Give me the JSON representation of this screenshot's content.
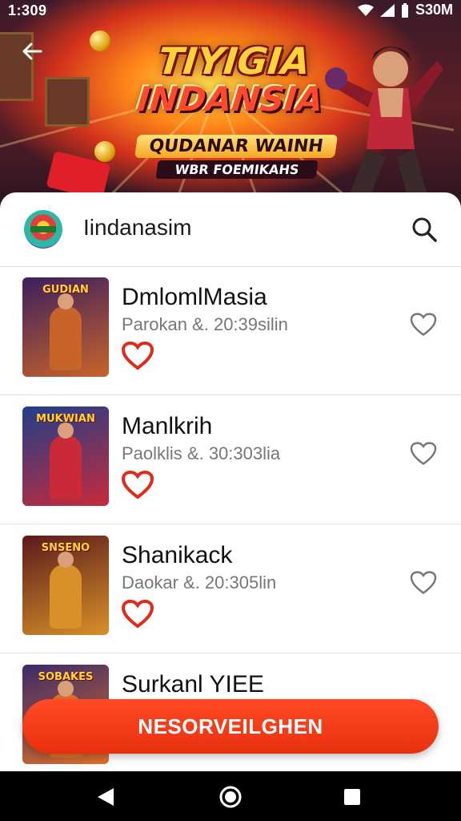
{
  "status_bar": {
    "time": "1:309",
    "battery": "S30M"
  },
  "hero": {
    "title_line1": "TIYIGIA",
    "title_line2": "INDANSIA",
    "subtitle": "QUDANAR WAINH",
    "tagline": "WBR FOEMIKAHS"
  },
  "search_bar": {
    "title": "Iindanasim"
  },
  "games": [
    {
      "name": "DmlomlMasia",
      "meta": "Parokan  &. 20:39silin",
      "thumb_title": "GUDIAN",
      "colors": [
        "#3b1f5e",
        "#c8642a"
      ]
    },
    {
      "name": "Manlkrih",
      "meta": "Paolklis  &. 30:303lia",
      "thumb_title": "MUKWIAN",
      "colors": [
        "#1d3f8a",
        "#c82a3a"
      ]
    },
    {
      "name": "Shanikack",
      "meta": "Daokar  &. 20:305lin",
      "thumb_title": "SNSENO",
      "colors": [
        "#5a1a1a",
        "#d8902a"
      ]
    },
    {
      "name": "Surkanl YIEE",
      "meta": "",
      "thumb_title": "SOBAKES",
      "colors": [
        "#3a2a6a",
        "#e0702a"
      ]
    }
  ],
  "cta": {
    "label": "NESORVEILGHEN"
  },
  "colors": {
    "accent": "#e8300f",
    "favorite": "#e02a1a"
  }
}
